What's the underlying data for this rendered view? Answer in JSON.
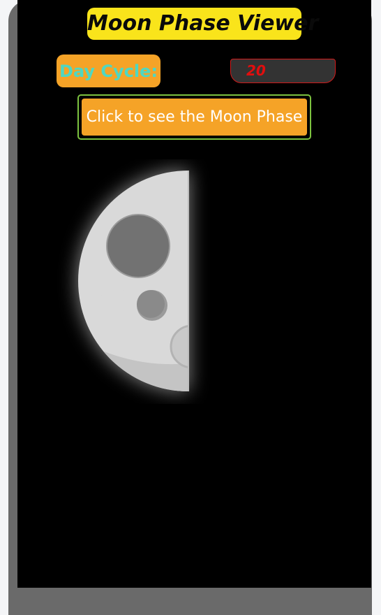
{
  "app": {
    "title": "Moon Phase Viewer"
  },
  "controls": {
    "day_cycle_label": "Day Cycle:",
    "day_cycle_value": "20",
    "show_button_label": "Click to see the Moon Phase"
  },
  "moon": {
    "icon": "half-moon-icon",
    "phase_shown": "last quarter"
  },
  "colors": {
    "title_bg": "#f9e41b",
    "accent_orange": "#f5a327",
    "label_text": "#4fd7c2",
    "input_text": "#e10e0e",
    "button_border": "#7cc23f",
    "screen_bg": "#000000",
    "frame": "#6a6a6a"
  }
}
